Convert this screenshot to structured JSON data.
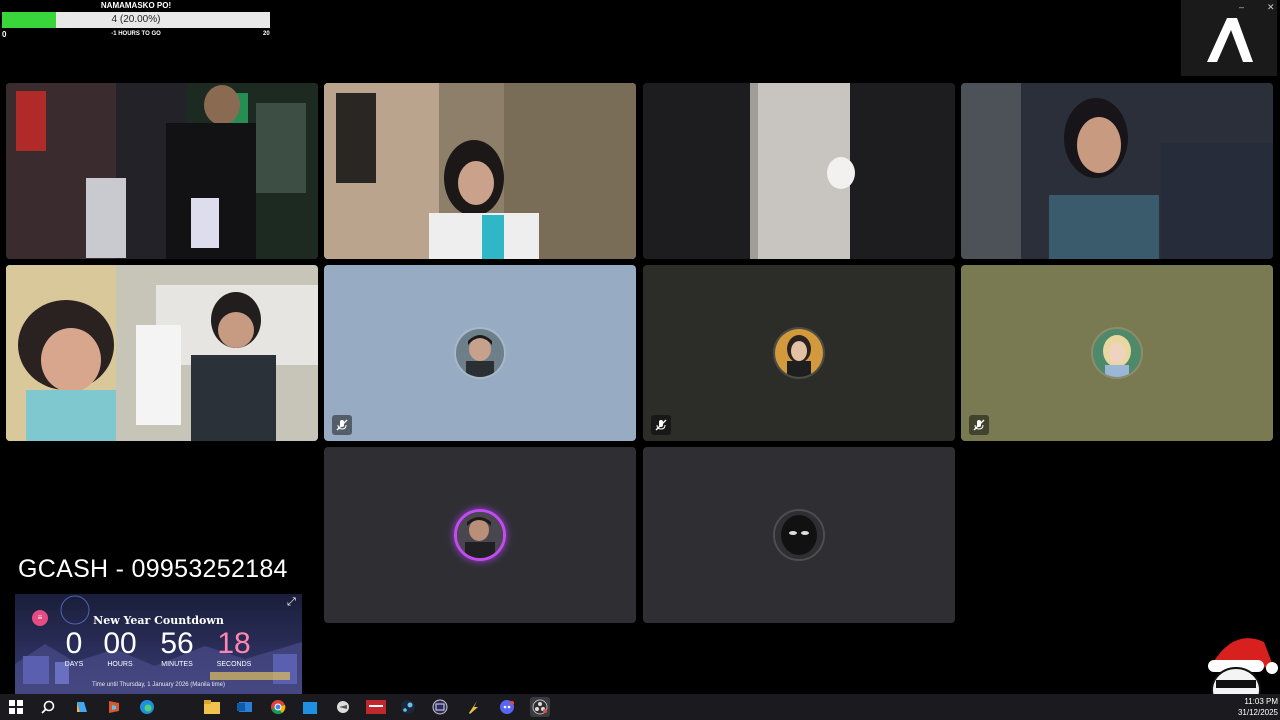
{
  "goal": {
    "title": "NAMAMASKO PO!",
    "progress_text": "4 (20.00%)",
    "progress_fraction": 0.2,
    "min": "0",
    "max": "20",
    "subtitle": "-1 HOURS TO GO",
    "fill_color": "#39d63b"
  },
  "window_controls": {
    "minimize": "–",
    "close": "✕"
  },
  "logo": {
    "icon": "stylized-a-logo-icon"
  },
  "tiles": [
    {
      "name": "participant-1",
      "type": "video",
      "speaking": true
    },
    {
      "name": "participant-2",
      "type": "video",
      "speaking": true
    },
    {
      "name": "participant-3",
      "type": "video",
      "speaking": false
    },
    {
      "name": "participant-4",
      "type": "video",
      "speaking": false
    },
    {
      "name": "participant-5",
      "type": "video",
      "speaking": true
    },
    {
      "name": "participant-6",
      "type": "avatar",
      "bg": "#97acc2",
      "muted": true
    },
    {
      "name": "participant-7",
      "type": "avatar",
      "bg": "#2c2c29",
      "muted": true
    },
    {
      "name": "participant-8",
      "type": "avatar",
      "bg": "#797a52",
      "muted": true
    },
    {
      "name": "participant-9",
      "type": "avatar",
      "bg": "#2f2f33",
      "muted": false,
      "ring": true
    },
    {
      "name": "participant-10",
      "type": "avatar",
      "bg": "#2f2f33",
      "muted": false
    }
  ],
  "gcash": {
    "text": "GCASH - 09953252184"
  },
  "countdown": {
    "title": "New Year Countdown",
    "days": "0",
    "hours": "00",
    "minutes": "56",
    "seconds": "18",
    "days_label": "DAYS",
    "hours_label": "HOURS",
    "minutes_label": "MINUTES",
    "seconds_label": "SECONDS",
    "footer": "Time until Thursday, 1 January 2026 (Manila time)",
    "badge": "≡",
    "expand": "⤢"
  },
  "taskbar": {
    "icons": [
      "windows-start-icon",
      "search-icon",
      "copilot-icon",
      "ms365-icon",
      "edge-icon",
      "file-explorer-icon",
      "outlook-icon",
      "chrome-icon",
      "store-icon",
      "app-icon",
      "video-app-icon",
      "steam-icon",
      "grid-app-icon",
      "bolt-app-icon",
      "discord-icon",
      "obs-icon"
    ],
    "clock_time": "11:03 PM",
    "clock_date": "31/12/2025"
  }
}
